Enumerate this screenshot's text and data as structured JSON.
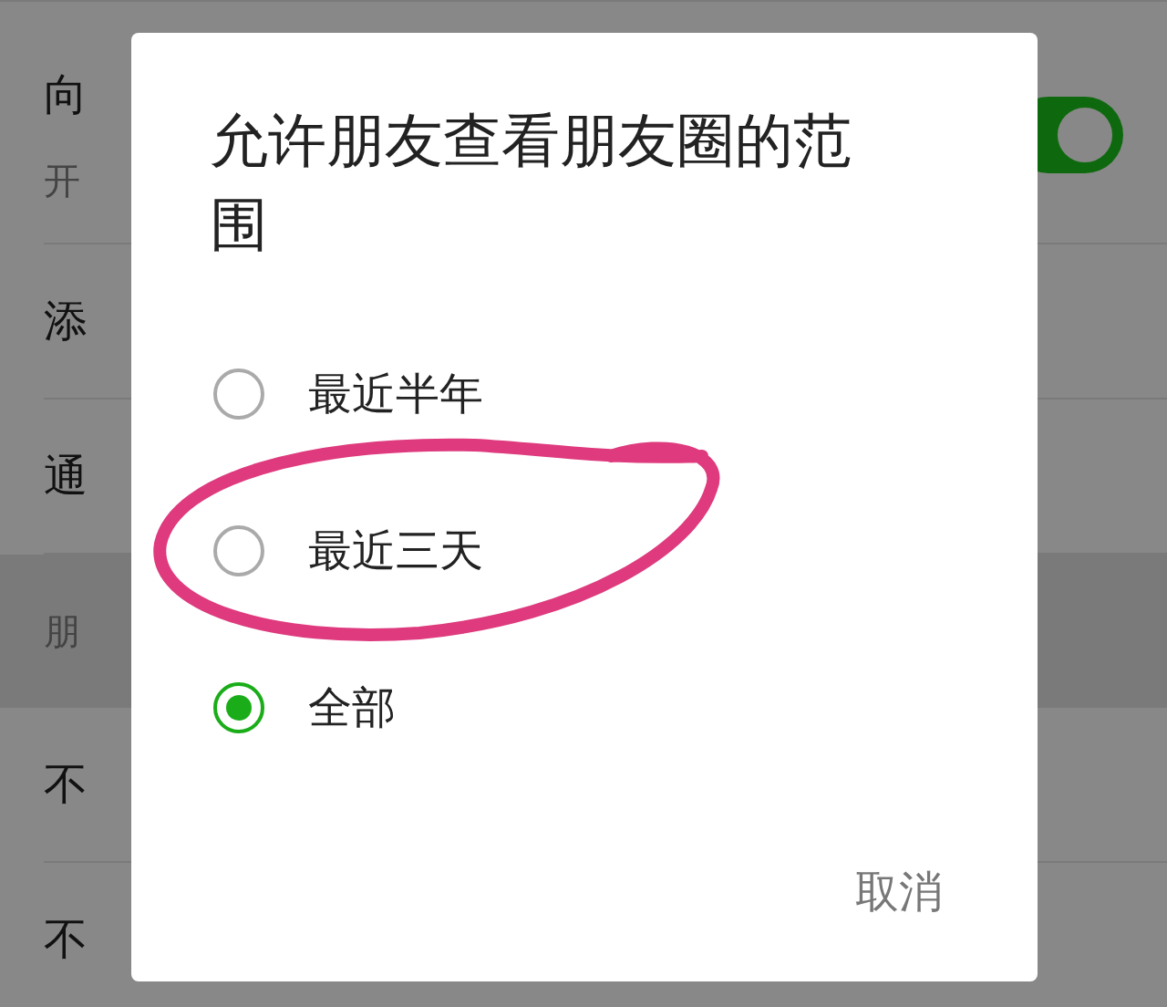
{
  "settings_list": [
    {
      "kind": "toggle_row",
      "title": "向",
      "subtitle": "开",
      "on": true
    },
    {
      "kind": "row",
      "title": "添"
    },
    {
      "kind": "row",
      "title": "通"
    },
    {
      "kind": "section",
      "title": "朋"
    },
    {
      "kind": "row",
      "title": "不"
    },
    {
      "kind": "row",
      "title": "不"
    }
  ],
  "dialog": {
    "title": "允许朋友查看朋友圈的范围",
    "options": [
      {
        "label": "最近半年",
        "selected": false
      },
      {
        "label": "最近三天",
        "selected": false
      },
      {
        "label": "全部",
        "selected": true
      }
    ],
    "buttons": [
      "取消"
    ]
  }
}
